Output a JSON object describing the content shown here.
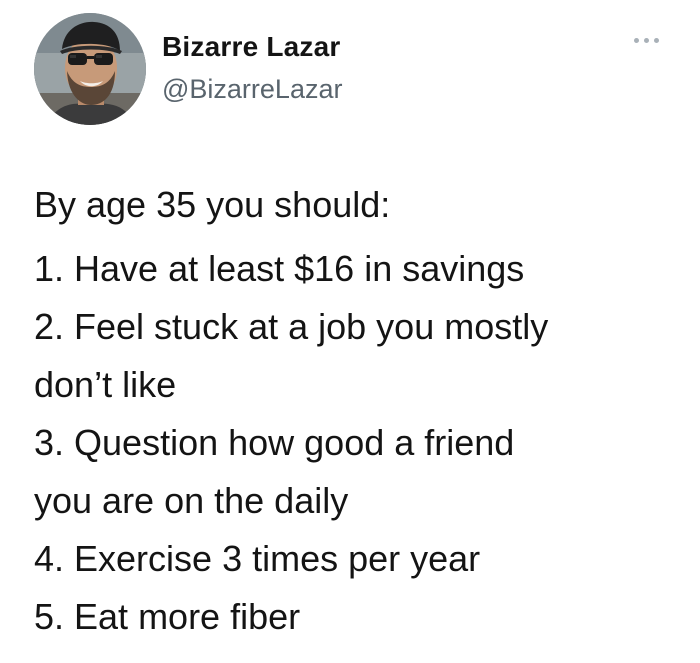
{
  "author": {
    "display_name": "Bizarre Lazar",
    "handle": "@BizarreLazar",
    "avatar_icon": "profile-photo"
  },
  "menu": {
    "icon": "more-horizontal-icon"
  },
  "tweet": {
    "intro": "By age 35 you should:",
    "lines": [
      "1. Have at least $16 in savings",
      "2. Feel stuck at a job you mostly",
      "don’t like",
      "3. Question how good a friend",
      "you are on the daily",
      "4. Exercise 3 times per year",
      "5. Eat more fiber"
    ]
  },
  "colors": {
    "text": "#141414",
    "handle": "#59646d",
    "menu_dots": "#a9b1b8",
    "background": "#ffffff"
  }
}
